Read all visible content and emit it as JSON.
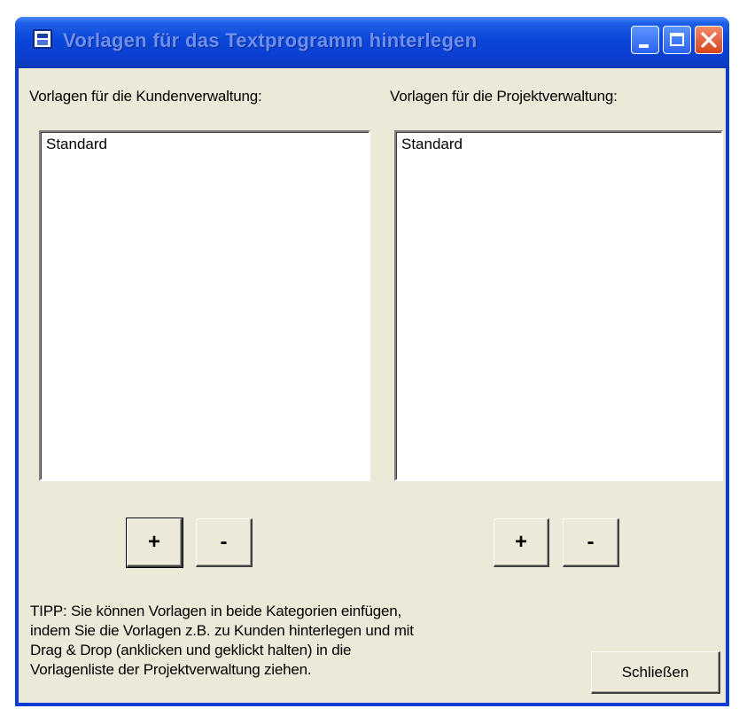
{
  "window": {
    "title": "Vorlagen für das Textprogramm hinterlegen"
  },
  "left_panel": {
    "label": "Vorlagen für die Kundenverwaltung:",
    "items": [
      "Standard"
    ],
    "add_label": "+",
    "remove_label": "-"
  },
  "right_panel": {
    "label": "Vorlagen für die Projektverwaltung:",
    "items": [
      "Standard"
    ],
    "add_label": "+",
    "remove_label": "-"
  },
  "tip": {
    "lines": [
      "TIPP: Sie können Vorlagen in beide Kategorien einfügen,",
      "indem Sie die Vorlagen z.B. zu Kunden hinterlegen und mit",
      "Drag & Drop (anklicken und geklickt halten) in die",
      "Vorlagenliste der Projektverwaltung ziehen."
    ]
  },
  "footer": {
    "close_label": "Schließen"
  },
  "icons": {
    "app": "app-icon",
    "minimize": "minimize-icon",
    "maximize": "maximize-icon",
    "close": "close-icon"
  },
  "colors": {
    "titlebar": "#0a46d8",
    "client_bg": "#ece9d8",
    "close_button": "#d8451f"
  }
}
